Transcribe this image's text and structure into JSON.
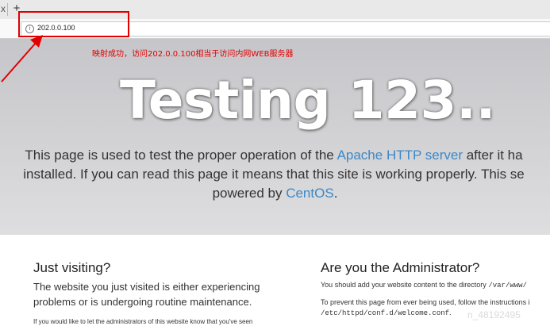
{
  "browser": {
    "tab_close_glyph": "x",
    "new_tab_glyph": "+",
    "info_icon_glyph": "i",
    "url": "202.0.0.100",
    "accent_red": "#e10000"
  },
  "annotation": "映射成功，访问202.0.0.100相当于访问内网WEB服务器",
  "hero": {
    "title": "Testing 123..",
    "line1_pre": "This page is used to test the proper operation of the ",
    "line1_link": "Apache HTTP server",
    "line1_post": " after it ha",
    "line2": "installed. If you can read this page it means that this site is working properly. This se",
    "line3_pre": "powered by ",
    "line3_link": "CentOS",
    "line3_post": "."
  },
  "left_column": {
    "heading": "Just visiting?",
    "para_line1": "The website you just visited is either experiencing",
    "para_line2": "problems or is undergoing routine maintenance.",
    "small_line": "If you would like to let the administrators of this website know that you've seen"
  },
  "right_column": {
    "heading": "Are you the Administrator?",
    "line1_pre": "You should add your website content to the directory ",
    "line1_code": "/var/www/",
    "line2": "To prevent this page from ever being used, follow the instructions i",
    "line3_code": "/etc/httpd/conf.d/welcome.conf",
    "line3_post": "."
  },
  "watermark": "n_48192495"
}
